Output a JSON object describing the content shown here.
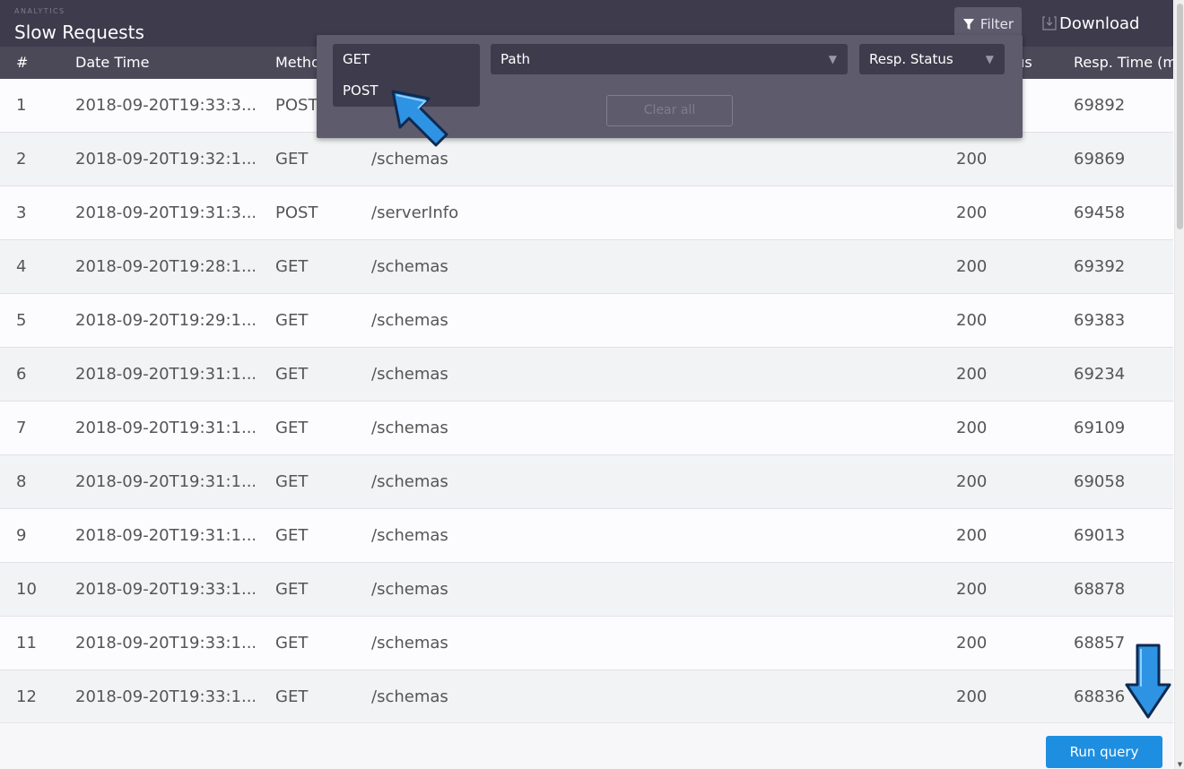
{
  "header": {
    "eyebrow": "ANALYTICS",
    "title": "Slow Requests",
    "filter_label": "Filter",
    "download_label": "Download"
  },
  "table": {
    "columns": {
      "num": "#",
      "date": "Date Time",
      "method": "Metho",
      "status": "tus",
      "time": "Resp. Time (ms"
    },
    "rows": [
      {
        "num": "1",
        "date": "2018-09-20T19:33:3...",
        "method": "POST",
        "path": "",
        "status": "",
        "time": "69892"
      },
      {
        "num": "2",
        "date": "2018-09-20T19:32:1...",
        "method": "GET",
        "path": "/schemas",
        "status": "200",
        "time": "69869"
      },
      {
        "num": "3",
        "date": "2018-09-20T19:31:3...",
        "method": "POST",
        "path": "/serverInfo",
        "status": "200",
        "time": "69458"
      },
      {
        "num": "4",
        "date": "2018-09-20T19:28:1...",
        "method": "GET",
        "path": "/schemas",
        "status": "200",
        "time": "69392"
      },
      {
        "num": "5",
        "date": "2018-09-20T19:29:1...",
        "method": "GET",
        "path": "/schemas",
        "status": "200",
        "time": "69383"
      },
      {
        "num": "6",
        "date": "2018-09-20T19:31:1...",
        "method": "GET",
        "path": "/schemas",
        "status": "200",
        "time": "69234"
      },
      {
        "num": "7",
        "date": "2018-09-20T19:31:1...",
        "method": "GET",
        "path": "/schemas",
        "status": "200",
        "time": "69109"
      },
      {
        "num": "8",
        "date": "2018-09-20T19:31:1...",
        "method": "GET",
        "path": "/schemas",
        "status": "200",
        "time": "69058"
      },
      {
        "num": "9",
        "date": "2018-09-20T19:31:1...",
        "method": "GET",
        "path": "/schemas",
        "status": "200",
        "time": "69013"
      },
      {
        "num": "10",
        "date": "2018-09-20T19:33:1...",
        "method": "GET",
        "path": "/schemas",
        "status": "200",
        "time": "68878"
      },
      {
        "num": "11",
        "date": "2018-09-20T19:33:1...",
        "method": "GET",
        "path": "/schemas",
        "status": "200",
        "time": "68857"
      },
      {
        "num": "12",
        "date": "2018-09-20T19:33:1...",
        "method": "GET",
        "path": "/schemas",
        "status": "200",
        "time": "68836"
      }
    ]
  },
  "filter_panel": {
    "method_options": [
      "GET",
      "POST"
    ],
    "path_placeholder": "Path",
    "status_placeholder": "Resp. Status",
    "clear_label": "Clear all"
  },
  "footer": {
    "run_label": "Run query"
  },
  "colors": {
    "header_bg": "#3d3b4c",
    "panel_bg": "#5e5b6d",
    "accent": "#1e8fe0"
  },
  "icons": {
    "filter": "funnel-icon",
    "download": "download-icon",
    "caret": "caret-down-icon",
    "pointer": "arrow-cursor-icon"
  }
}
